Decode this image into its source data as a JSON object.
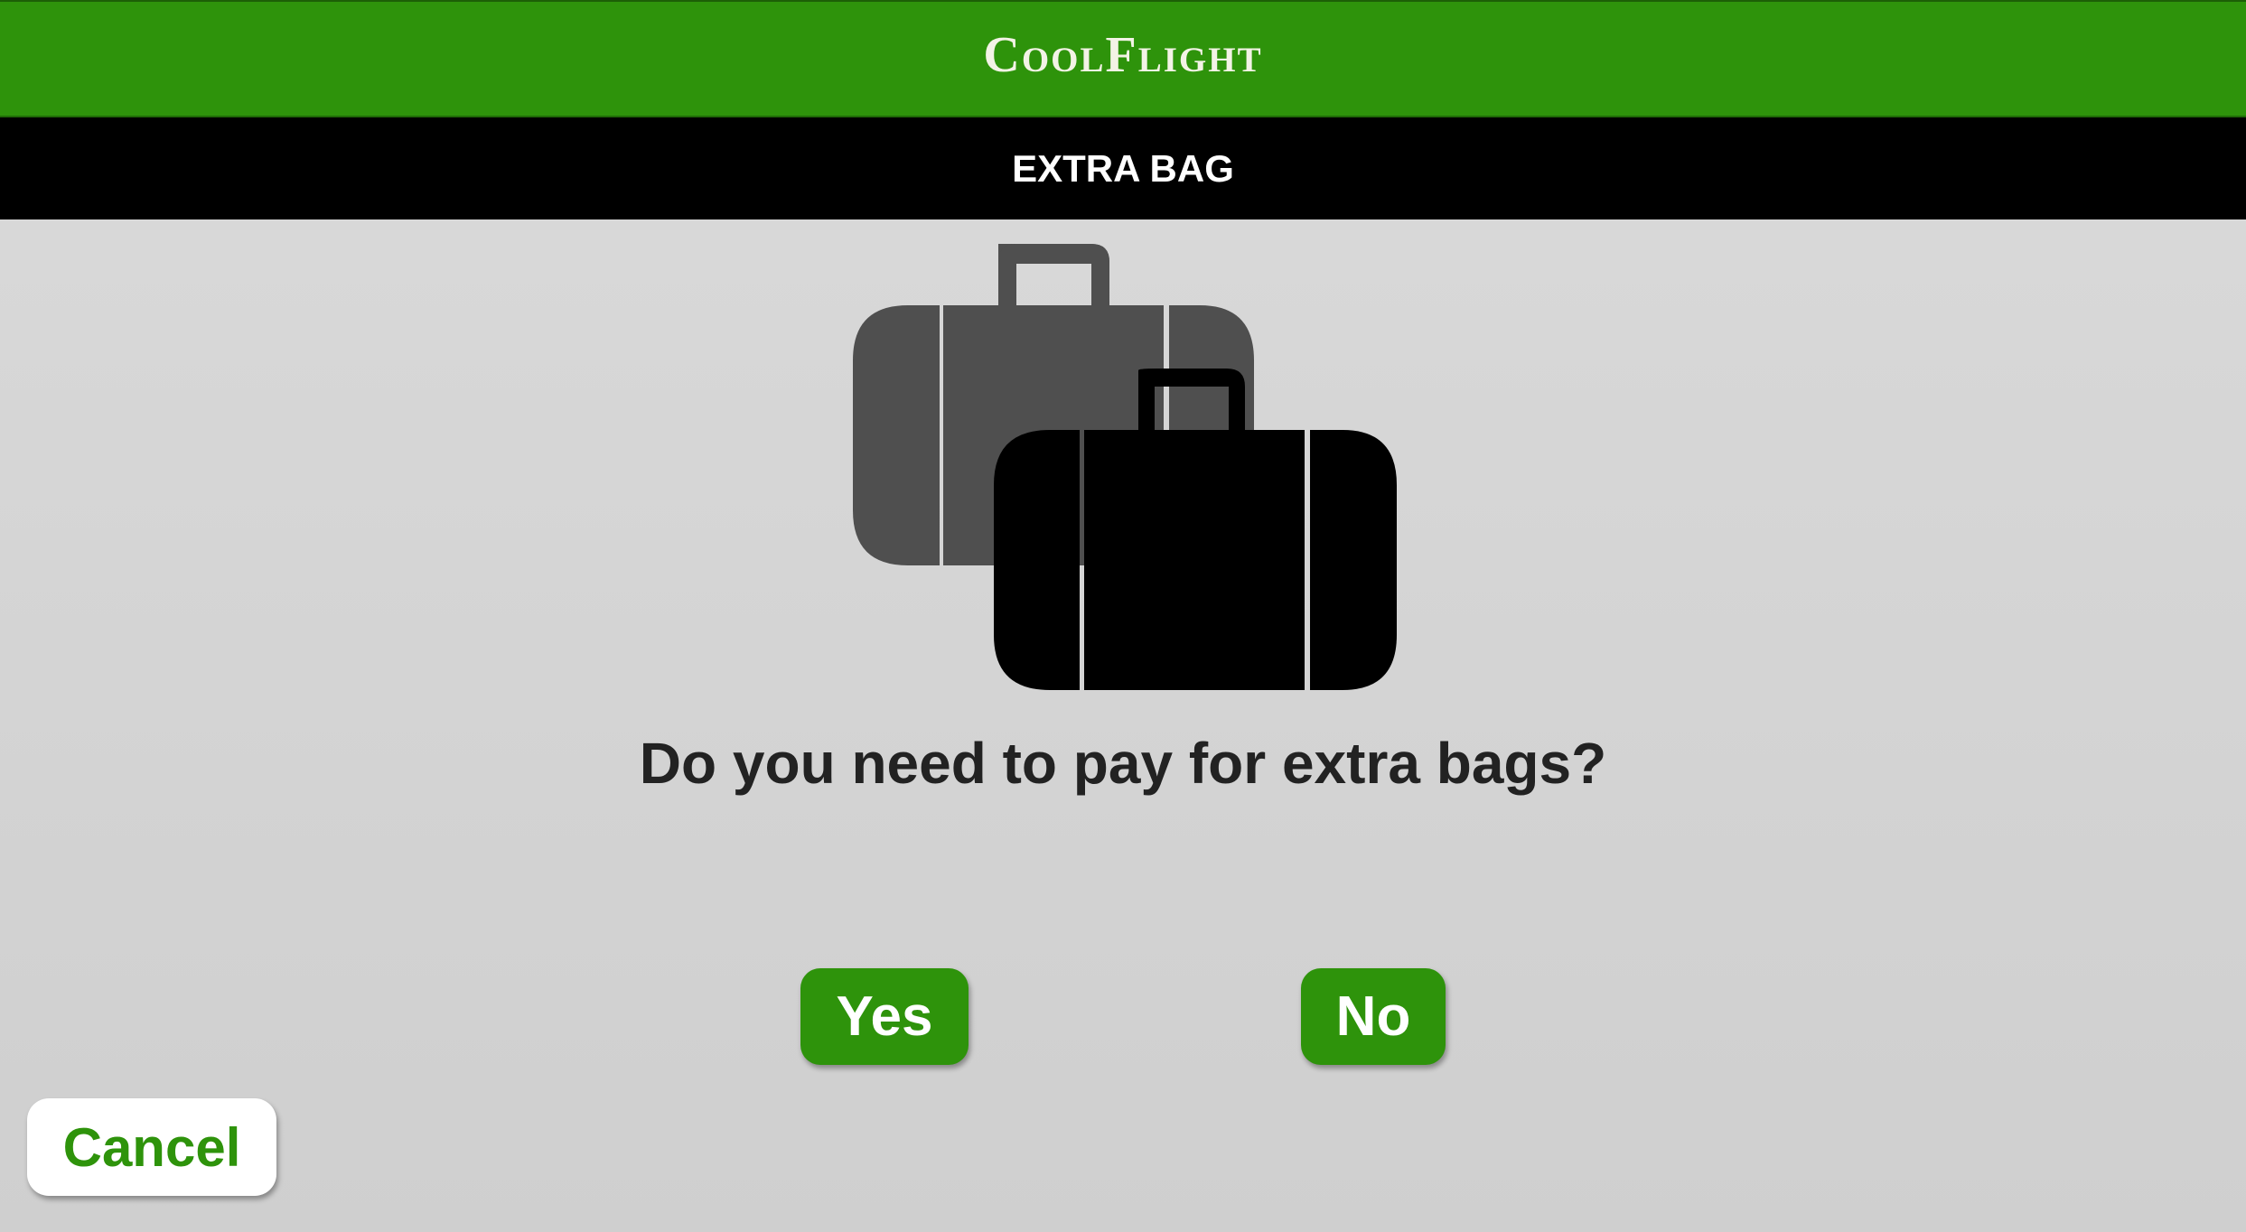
{
  "app": {
    "brand": "CoolFlight"
  },
  "header": {
    "title": "EXTRA BAG"
  },
  "illustration": {
    "icon": "luggage-icon",
    "back_color": "#4f4f4f",
    "front_color": "#000000"
  },
  "main": {
    "question": "Do you need to pay for extra bags?"
  },
  "actions": {
    "yes_label": "Yes",
    "no_label": "No",
    "cancel_label": "Cancel"
  },
  "colors": {
    "brand_green": "#2e930b",
    "header_black": "#000000",
    "background": "#d4d4d4"
  }
}
